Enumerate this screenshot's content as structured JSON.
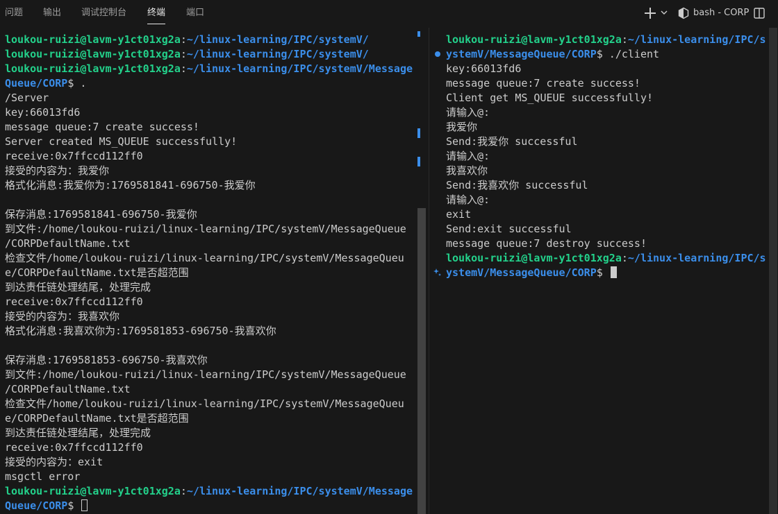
{
  "panel_tabs": [
    {
      "label": "问题",
      "active": false
    },
    {
      "label": "输出",
      "active": false
    },
    {
      "label": "调试控制台",
      "active": false
    },
    {
      "label": "终端",
      "active": true
    },
    {
      "label": "端口",
      "active": false
    }
  ],
  "toolbar": {
    "new_terminal_icon": "plus-icon",
    "dropdown_icon": "chevron-down-icon",
    "terminal_icon": "terminal-cube-icon",
    "terminal_title": "bash - CORP",
    "split_icon": "split-editor-icon"
  },
  "colors": {
    "background": "#181818",
    "prompt_user": "#23d18b",
    "prompt_path": "#3b8eea",
    "text": "#cccccc"
  },
  "terminal_left": {
    "lines": [
      {
        "user": "loukou-ruizi@lavm-y1ct01xg2a",
        "sep": ":",
        "path": "~/linux-learning/IPC/systemV/",
        "cmd": ""
      },
      {
        "user": "loukou-ruizi@lavm-y1ct01xg2a",
        "sep": ":",
        "path": "~/linux-learning/IPC/systemV/",
        "cmd": ""
      },
      {
        "user": "loukou-ruizi@lavm-y1ct01xg2a",
        "sep": ":",
        "path": "~/linux-learning/IPC/systemV/Message",
        "cmd": ""
      },
      {
        "path": "Queue/CORP",
        "cmd": "$ ."
      },
      {
        "text": "/Server"
      },
      {
        "text": "key:66013fd6"
      },
      {
        "text": "message queue:7 create success!"
      },
      {
        "text": "Server created MS_QUEUE successfully!"
      },
      {
        "text": "receive:0x7ffccd112ff0"
      },
      {
        "text": "接受的内容为：我爱你"
      },
      {
        "text": "格式化消息:我爱你为:1769581841-696750-我爱你"
      },
      {
        "text": ""
      },
      {
        "text": "保存消息:1769581841-696750-我爱你"
      },
      {
        "text": "到文件:/home/loukou-ruizi/linux-learning/IPC/systemV/MessageQueue"
      },
      {
        "text": "/CORPDefaultName.txt"
      },
      {
        "text": "检查文件/home/loukou-ruizi/linux-learning/IPC/systemV/MessageQueu"
      },
      {
        "text": "e/CORPDefaultName.txt是否超范围"
      },
      {
        "text": "到达责任链处理结尾，处理完成"
      },
      {
        "text": "receive:0x7ffccd112ff0"
      },
      {
        "text": "接受的内容为：我喜欢你"
      },
      {
        "text": "格式化消息:我喜欢你为:1769581853-696750-我喜欢你"
      },
      {
        "text": ""
      },
      {
        "text": "保存消息:1769581853-696750-我喜欢你"
      },
      {
        "text": "到文件:/home/loukou-ruizi/linux-learning/IPC/systemV/MessageQueue"
      },
      {
        "text": "/CORPDefaultName.txt"
      },
      {
        "text": "检查文件/home/loukou-ruizi/linux-learning/IPC/systemV/MessageQueu"
      },
      {
        "text": "e/CORPDefaultName.txt是否超范围"
      },
      {
        "text": "到达责任链处理结尾，处理完成"
      },
      {
        "text": "receive:0x7ffccd112ff0"
      },
      {
        "text": "接受的内容为：exit"
      },
      {
        "text": "msgctl error"
      },
      {
        "user": "loukou-ruizi@lavm-y1ct01xg2a",
        "sep": ":",
        "path": "~/linux-learning/IPC/systemV/Message",
        "cmd": ""
      },
      {
        "path": "Queue/CORP",
        "cmd": "$ ",
        "cursor": "hollow"
      }
    ]
  },
  "terminal_right": {
    "lines": [
      {
        "user": "loukou-ruizi@lavm-y1ct01xg2a",
        "sep": ":",
        "path": "~/linux-learning/IPC/s",
        "cmd": ""
      },
      {
        "path": "ystemV/MessageQueue/CORP",
        "cmd": "$ ./client",
        "deco": "dot"
      },
      {
        "text": "key:66013fd6"
      },
      {
        "text": "message queue:7 create success!"
      },
      {
        "text": "Client get MS_QUEUE successfully!"
      },
      {
        "text": "请输入@:"
      },
      {
        "text": "我爱你"
      },
      {
        "text": "Send:我爱你 successful"
      },
      {
        "text": "请输入@:"
      },
      {
        "text": "我喜欢你"
      },
      {
        "text": "Send:我喜欢你 successful"
      },
      {
        "text": "请输入@:"
      },
      {
        "text": "exit"
      },
      {
        "text": "Send:exit successful"
      },
      {
        "text": "message queue:7 destroy success!"
      },
      {
        "user": "loukou-ruizi@lavm-y1ct01xg2a",
        "sep": ":",
        "path": "~/linux-learning/IPC/s",
        "cmd": ""
      },
      {
        "path": "ystemV/MessageQueue/CORP",
        "cmd": "$ ",
        "cursor": "solid",
        "deco": "spark"
      }
    ]
  }
}
